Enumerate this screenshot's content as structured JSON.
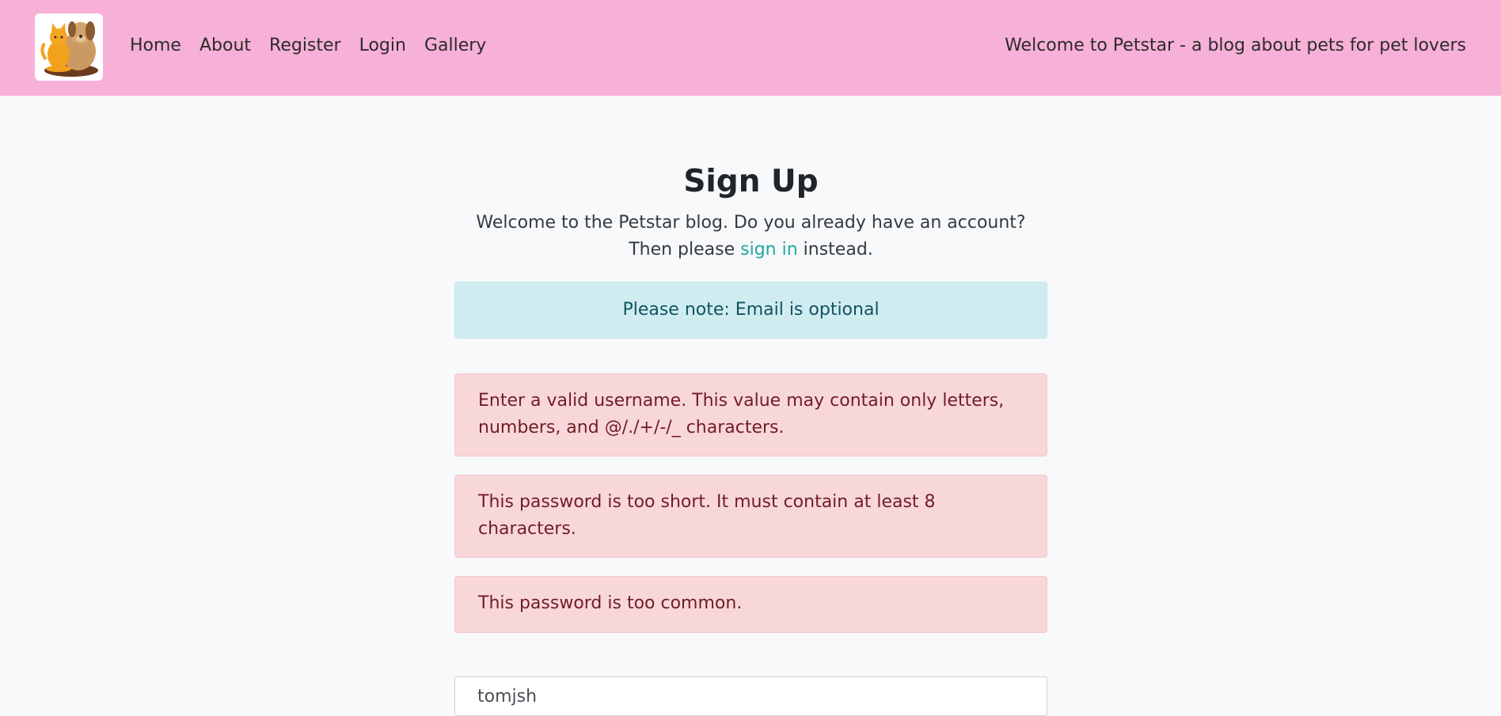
{
  "nav": {
    "links": [
      "Home",
      "About",
      "Register",
      "Login",
      "Gallery"
    ],
    "tagline": "Welcome to Petstar - a blog about pets for pet lovers"
  },
  "signup": {
    "title": "Sign Up",
    "intro_before": "Welcome to the Petstar blog. Do you already have an account? Then please ",
    "signin_link": "sign in",
    "intro_after": " instead.",
    "info_note": "Please note: Email is optional",
    "errors": [
      "Enter a valid username. This value may contain only letters, numbers, and @/./+/-/_ characters.",
      "This password is too short. It must contain at least 8 characters.",
      "This password is too common."
    ],
    "username_value": "tomjsh"
  },
  "colors": {
    "navbar": "#f7b0d7",
    "page_background": "#f8f9fa",
    "link": "#20a8a0",
    "info_background": "#d1ecf1",
    "danger_background": "#f8d7da"
  },
  "icons": {
    "logo": "cat-and-dog-logo"
  }
}
